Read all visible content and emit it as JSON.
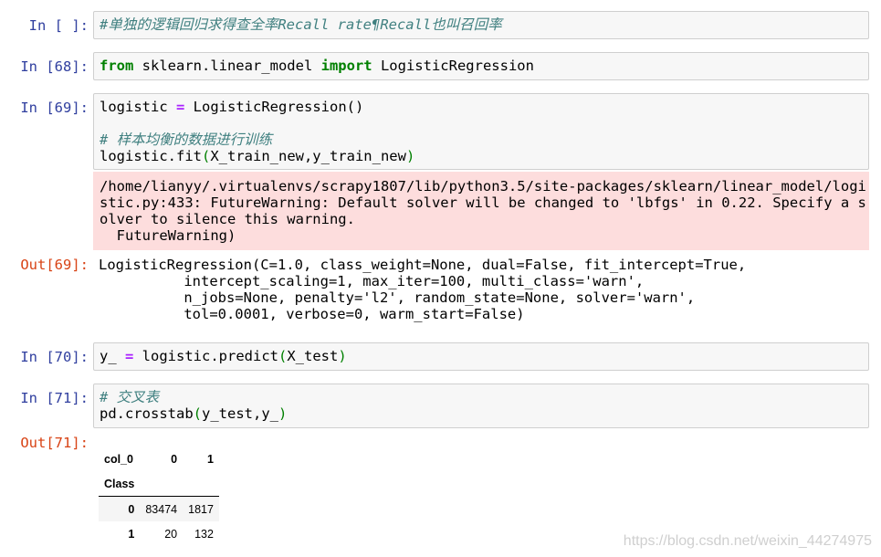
{
  "cells": [
    {
      "prompt": "In [ ]:",
      "code": "#单独的逻辑回归求得查全率Recall rate¶Recall也叫召回率"
    },
    {
      "prompt": "In [68]:",
      "kw1": "from",
      "module": " sklearn.linear_model ",
      "kw2": "import",
      "name": " LogisticRegression"
    },
    {
      "prompt": "In [69]:",
      "line1_a": "logistic ",
      "line1_op": "=",
      "line1_b": " LogisticRegression()",
      "comment": "# 样本均衡的数据进行训练",
      "line3_a": "logistic.fit",
      "line3_p1": "(",
      "line3_b": "X_train_new,y_train_new",
      "line3_p2": ")",
      "stderr": "/home/lianyy/.virtualenvs/scrapy1807/lib/python3.5/site-packages/sklearn/linear_model/logi\nstic.py:433: FutureWarning: Default solver will be changed to 'lbfgs' in 0.22. Specify a s\nolver to silence this warning.\n  FutureWarning)",
      "out_prompt": "Out[69]:",
      "output": "LogisticRegression(C=1.0, class_weight=None, dual=False, fit_intercept=True,\n          intercept_scaling=1, max_iter=100, multi_class='warn',\n          n_jobs=None, penalty='l2', random_state=None, solver='warn',\n          tol=0.0001, verbose=0, warm_start=False)"
    },
    {
      "prompt": "In [70]:",
      "a": "y_ ",
      "op": "=",
      "b": " logistic.predict",
      "p1": "(",
      "c": "X_test",
      "p2": ")"
    },
    {
      "prompt": "In [71]:",
      "comment": "# 交叉表",
      "a": "pd.crosstab",
      "p1": "(",
      "b": "y_test,y_",
      "p2": ")",
      "out_prompt": "Out[71]:",
      "table": {
        "columns_name": "col_0",
        "columns": [
          "0",
          "1"
        ],
        "index_name": "Class",
        "rows": [
          {
            "index": "0",
            "values": [
              "83474",
              "1817"
            ]
          },
          {
            "index": "1",
            "values": [
              "20",
              "132"
            ]
          }
        ]
      }
    }
  ],
  "watermark": "https://blog.csdn.net/weixin_44274975"
}
